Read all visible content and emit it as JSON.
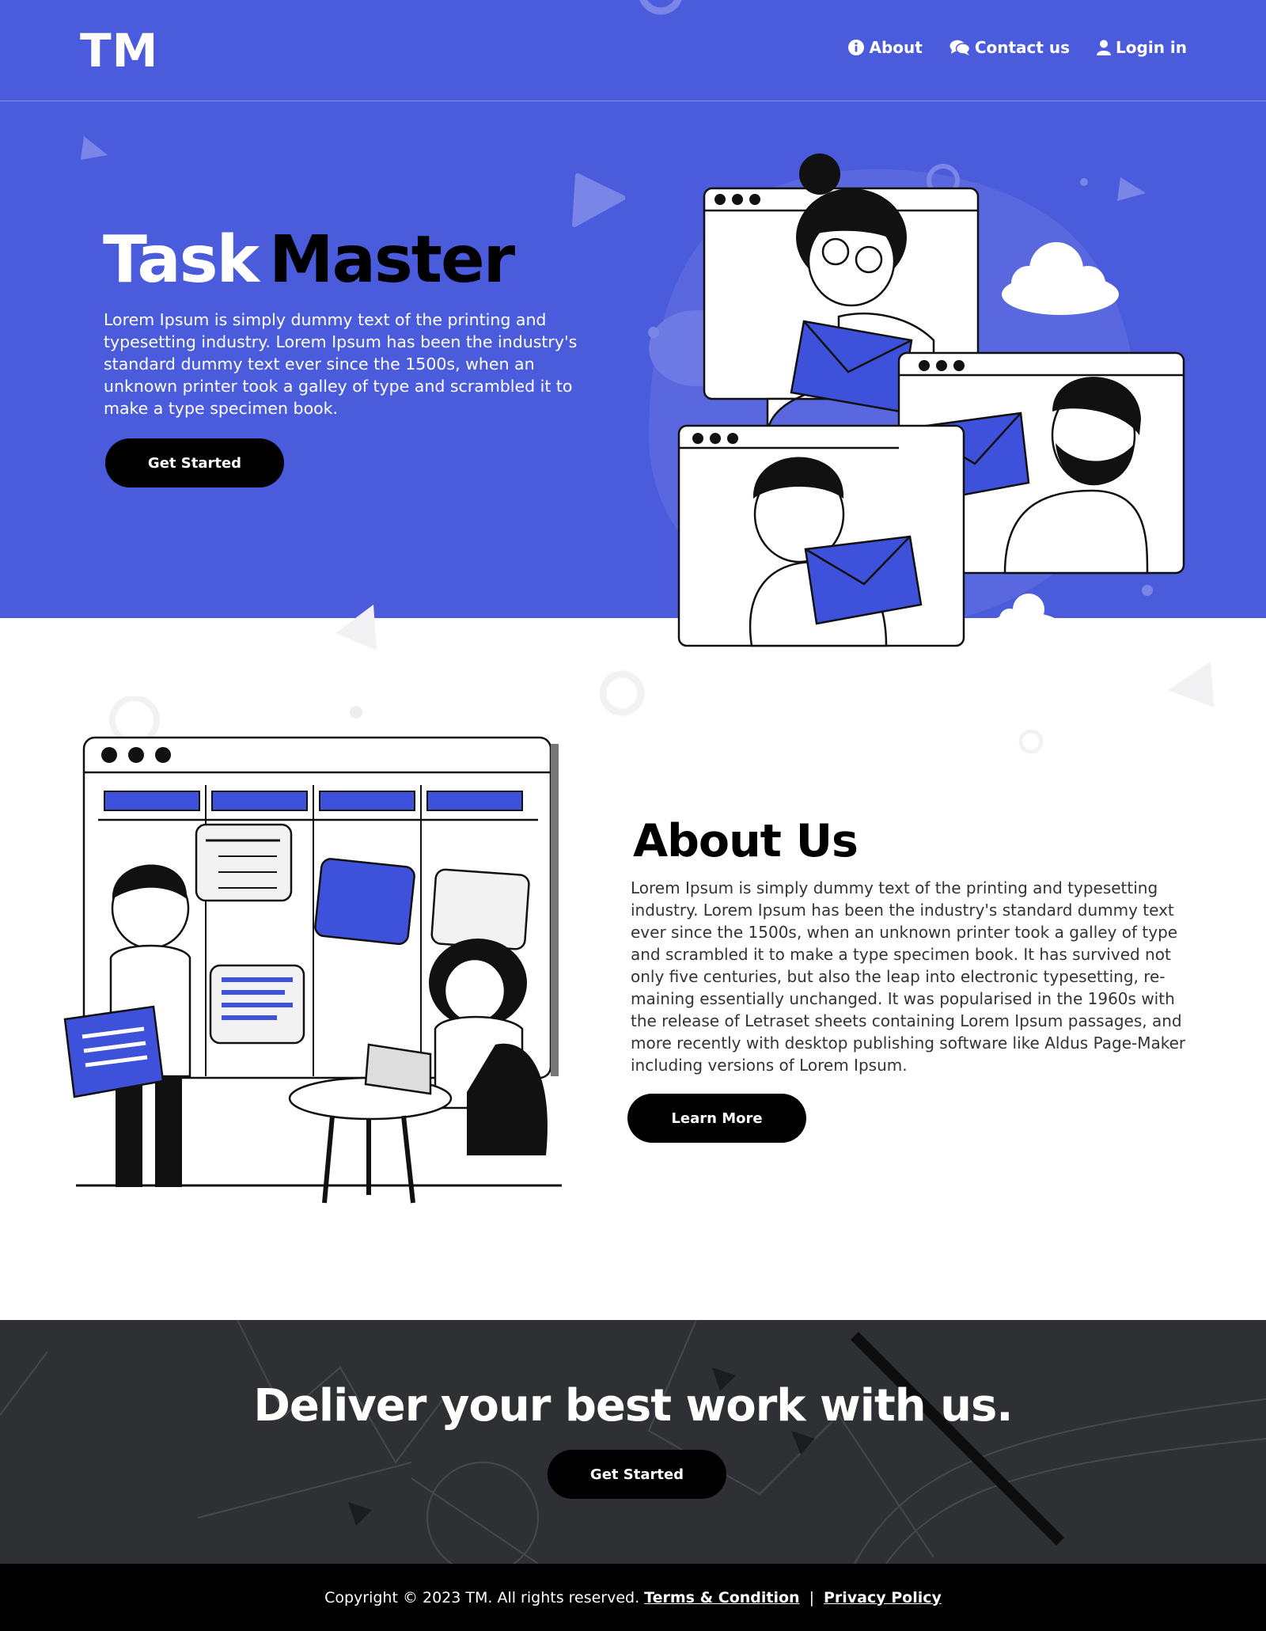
{
  "brand": {
    "logo": "TM",
    "accent_color": "#4a5bdc"
  },
  "nav": [
    {
      "label": "About",
      "icon": "info-icon"
    },
    {
      "label": "Contact us",
      "icon": "chat-icon"
    },
    {
      "label": "Login in",
      "icon": "user-icon"
    }
  ],
  "hero": {
    "title_part1": "Task",
    "title_part2": "Master",
    "text": "Lorem Ipsum is simply dummy text of the printing and typesetting industry. Lorem Ipsum has been the industry's standard dummy text ever since the 1500s, when an unknown printer took a galley of type and scrambled it to make a type specimen book.",
    "button": "Get Started"
  },
  "about": {
    "title": "About Us",
    "text": "Lorem Ipsum is simply dummy text of the printing and typesetting industry. Lorem Ipsum has been the industry's standard dummy text ever since the 1500s, when an unknown printer took a galley of type and scrambled it to make a type specimen book. It has survived not only five centuries, but also the leap into electronic typesetting, re-maining essentially unchanged. It was popularised in the 1960s with the release of Letraset sheets containing Lorem Ipsum passages, and more recently with desktop publishing software like Aldus Page-Maker including versions of Lorem Ipsum.",
    "button": "Learn More"
  },
  "cta": {
    "title": "Deliver your best work with us.",
    "button": "Get Started"
  },
  "footer": {
    "copyright": "Copyright ©  2023 TM. All rights reserved.",
    "terms": "Terms & Condition",
    "separator": "|",
    "privacy": "Privacy Policy"
  }
}
